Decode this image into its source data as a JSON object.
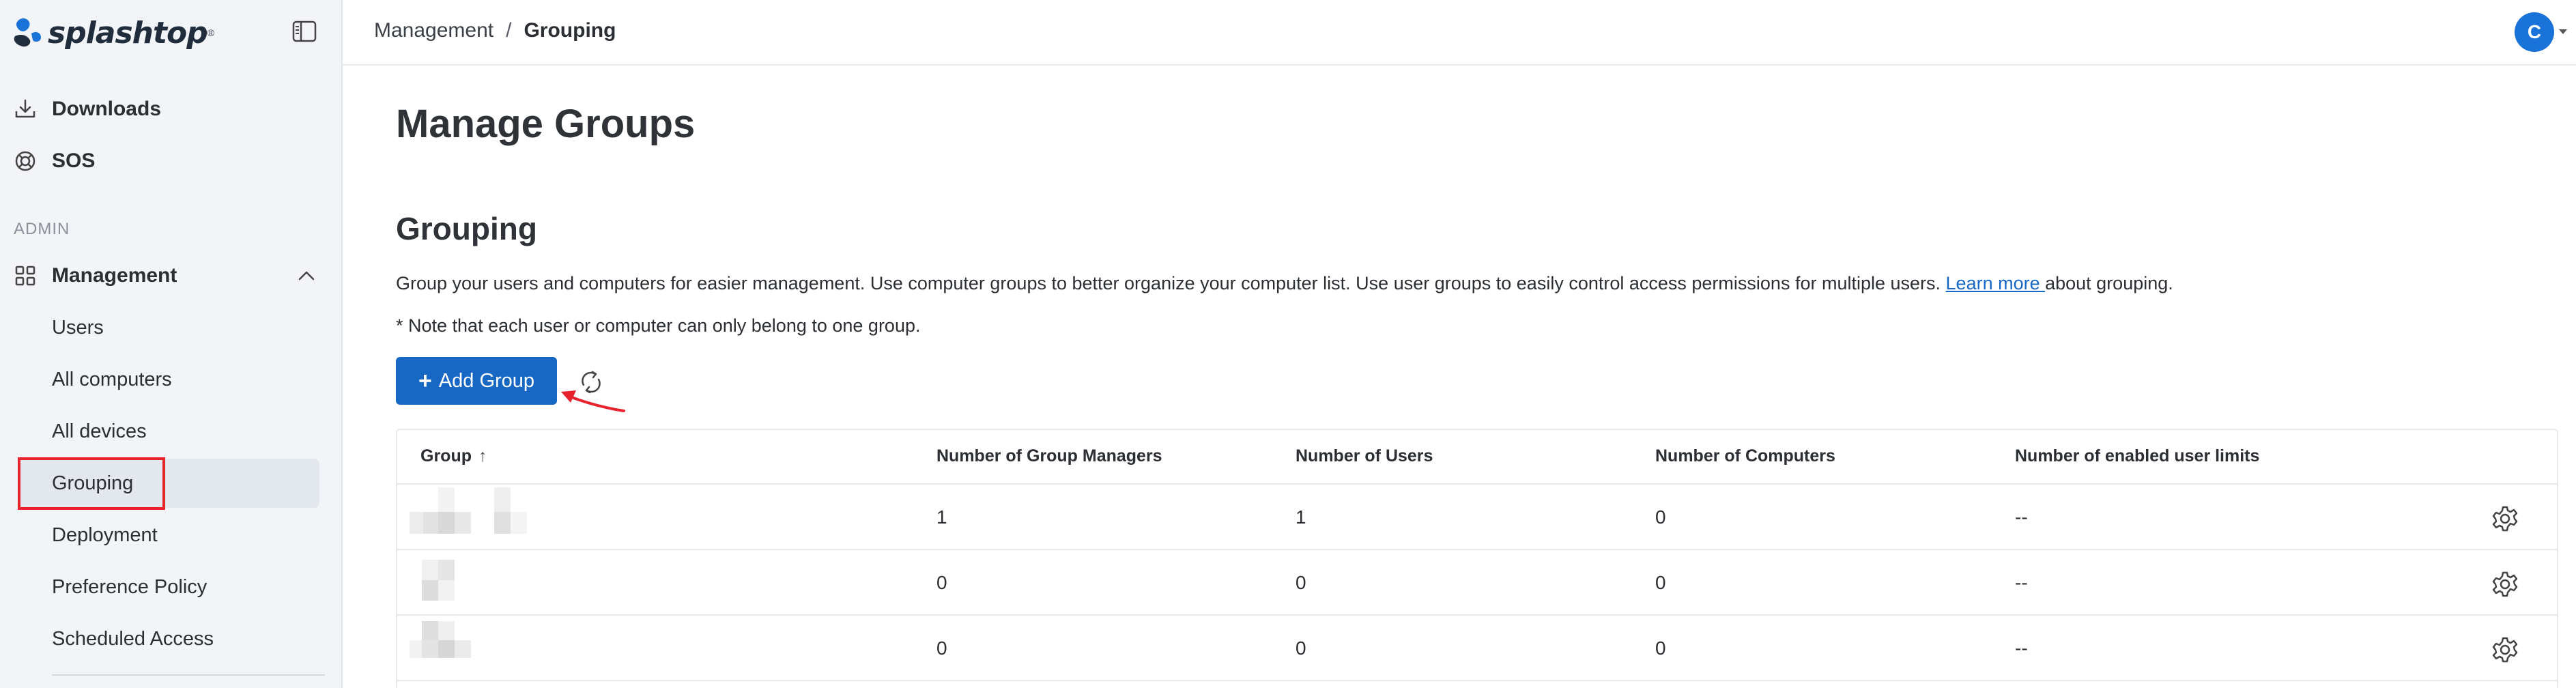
{
  "brand": {
    "name": "splashtop",
    "tm": "®"
  },
  "sidebar": {
    "items_top": [
      {
        "label": "Downloads",
        "icon": "download-icon"
      },
      {
        "label": "SOS",
        "icon": "sos-icon"
      }
    ],
    "section_label": "ADMIN",
    "management": {
      "label": "Management",
      "icon": "grid-icon",
      "expanded": true
    },
    "sub_items": [
      {
        "label": "Users"
      },
      {
        "label": "All computers"
      },
      {
        "label": "All devices"
      },
      {
        "label": "Grouping",
        "active": true
      },
      {
        "label": "Deployment"
      },
      {
        "label": "Preference Policy"
      },
      {
        "label": "Scheduled Access"
      }
    ]
  },
  "header": {
    "breadcrumb": {
      "parent": "Management",
      "separator": "/",
      "current": "Grouping"
    },
    "avatar_initial": "C"
  },
  "main": {
    "page_title": "Manage Groups",
    "section_title": "Grouping",
    "description_pre": "Group your users and computers for easier management. Use computer groups to better organize your computer list. Use user groups to easily control access permissions for multiple users. ",
    "learn_more": "Learn more ",
    "description_post": "about grouping.",
    "note": "* Note that each user or computer can only belong to one group.",
    "add_group_label": "Add Group"
  },
  "table": {
    "columns": [
      "Group",
      "Number of Group Managers",
      "Number of Users",
      "Number of Computers",
      "Number of enabled user limits"
    ],
    "sort_indicator": "↑",
    "rows": [
      {
        "managers": "1",
        "users": "1",
        "computers": "0",
        "limits": "--"
      },
      {
        "managers": "0",
        "users": "0",
        "computers": "0",
        "limits": "--"
      },
      {
        "managers": "0",
        "users": "0",
        "computers": "0",
        "limits": "--"
      }
    ]
  },
  "colors": {
    "accent": "#1668c4",
    "highlight": "#e8222c",
    "sidebar_bg": "#f2f4f7"
  }
}
